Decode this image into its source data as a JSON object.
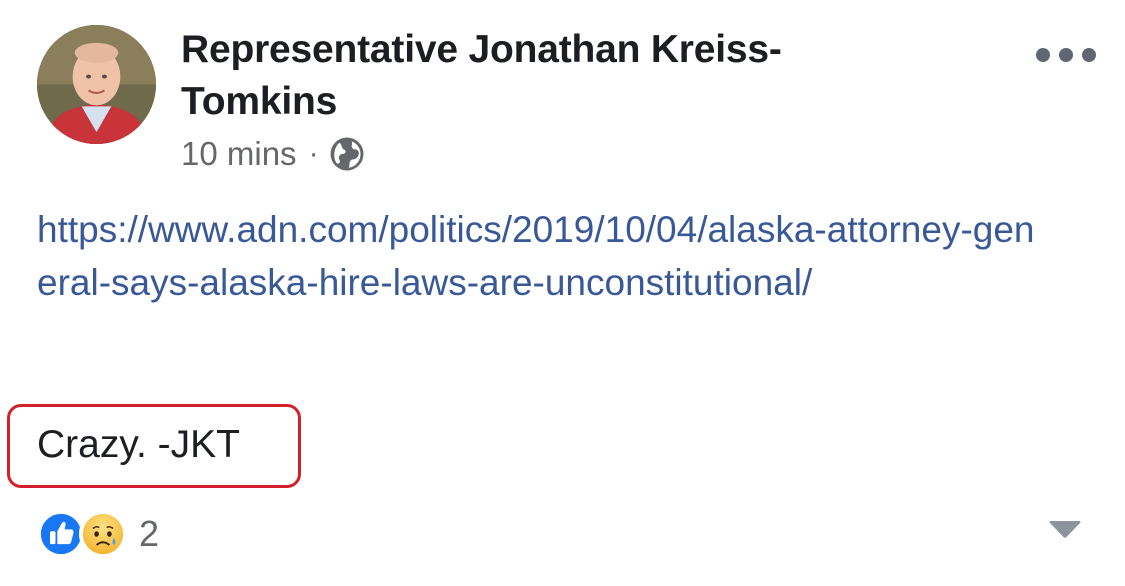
{
  "post": {
    "author": "Representative Jonathan Kreiss-Tomkins",
    "timestamp": "10 mins",
    "separator": "·",
    "audience_icon": "globe-icon",
    "link_text": "https://www.adn.com/politics/2019/10/04/alaska-attorney-general-says-alaska-hire-laws-are-unconstitutional/",
    "text": "Crazy. -JKT",
    "highlight_color": "#d4202a"
  },
  "reactions": {
    "icons": [
      "like-icon",
      "sad-icon"
    ],
    "count": "2"
  },
  "controls": {
    "more_icon": "more-icon",
    "menu_icon": "caret-down-icon"
  },
  "colors": {
    "link": "#385898",
    "secondary_text": "#65676b",
    "like_blue": "#1877f2"
  }
}
